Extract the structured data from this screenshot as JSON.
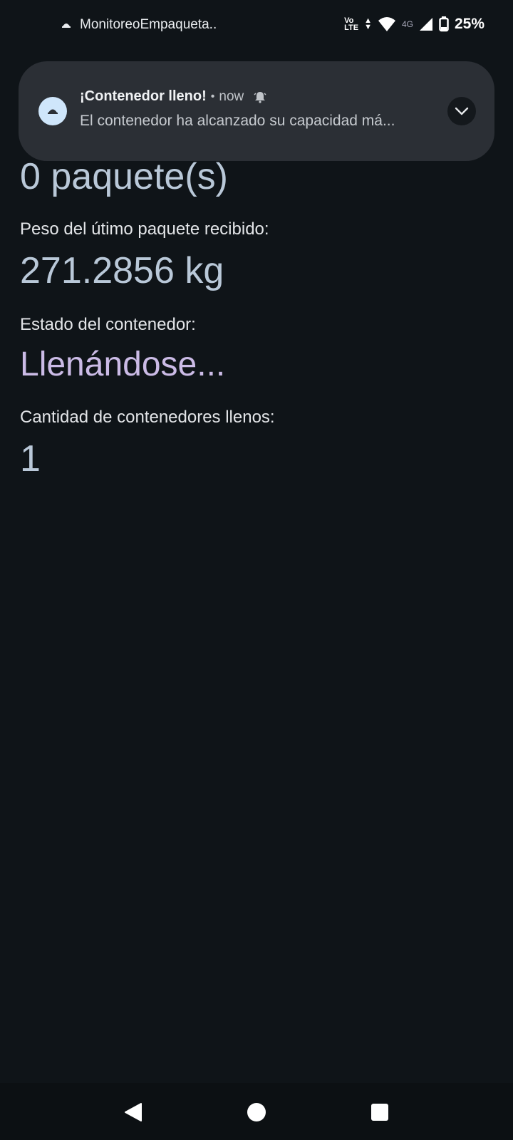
{
  "status_bar": {
    "app_name": "MonitoreoEmpaqueta..",
    "volte_top": "Vo",
    "volte_bottom": "LTE",
    "network_type": "4G",
    "battery": "25%"
  },
  "notification": {
    "title": "¡Contenedor lleno!",
    "separator": "•",
    "time": "now",
    "body": "El contenedor ha alcanzado su capacidad má..."
  },
  "main": {
    "package_count": "0 paquete(s)",
    "last_weight_label": "Peso del útimo paquete recibido:",
    "last_weight_value": "271.2856 kg",
    "container_status_label": "Estado del contenedor:",
    "container_status_value": "Llenándose...",
    "full_containers_label": "Cantidad de contenedores llenos:",
    "full_containers_value": "1"
  },
  "icons": {
    "status_app": "app-logo-icon",
    "wifi": "wifi-icon",
    "signal": "signal-icon",
    "battery": "battery-icon",
    "notif_app": "app-logo-icon",
    "bell": "bell-icon",
    "expand": "chevron-down-icon",
    "back": "back-triangle-icon",
    "home": "home-circle-icon",
    "recents": "recents-square-icon"
  },
  "colors": {
    "background": "#0f1418",
    "value_text": "#b9c8d8",
    "status_text": "#cbbbe6",
    "notification_bg": "#2b2f35"
  }
}
